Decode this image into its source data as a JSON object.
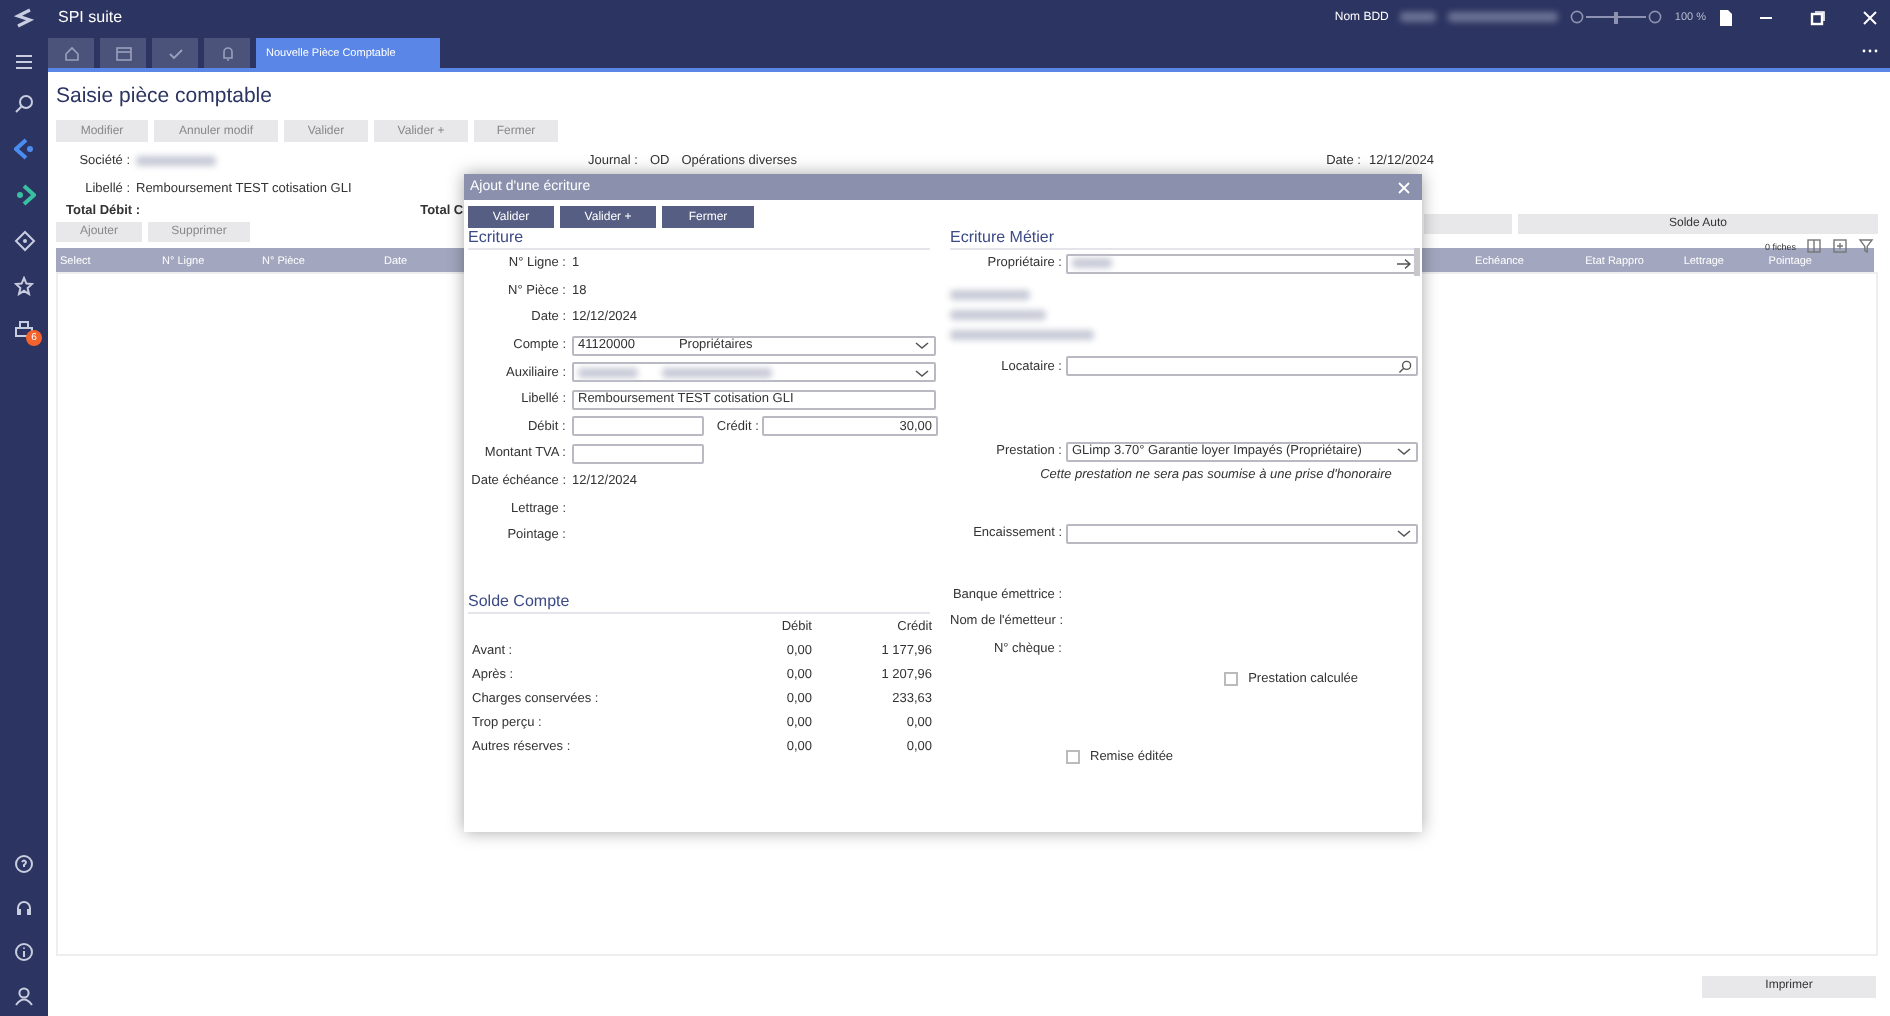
{
  "window": {
    "title": "SPI suite",
    "db_label": "Nom BDD",
    "zoom": "100 %",
    "zoom_slider": {
      "level": 0.5
    }
  },
  "tabs": [
    {
      "label": "Nouvelle Pièce Comptable",
      "selected": true
    }
  ],
  "sidebar": {
    "badge": "6"
  },
  "page": {
    "title": "Saisie pièce comptable",
    "toolbar": [
      {
        "label": "Modifier",
        "disabled": true
      },
      {
        "label": "Annuler modif",
        "disabled": true
      },
      {
        "label": "Valider",
        "disabled": true
      },
      {
        "label": "Valider +",
        "disabled": true
      },
      {
        "label": "Fermer",
        "disabled": true
      }
    ],
    "societe_label": "Société :",
    "libelle_label": "Libellé :",
    "libelle_value": "Remboursement TEST cotisation GLI",
    "journal_label": "Journal :",
    "journal_code": "OD",
    "journal_name": "Opérations diverses",
    "date_label": "Date :",
    "date_value": "12/12/2024",
    "total_debit": "Total Débit :",
    "total_credit": "Total C",
    "line_buttons": [
      {
        "label": "Ajouter",
        "disabled": true
      },
      {
        "label": "Supprimer",
        "disabled": true
      }
    ],
    "solde_button": "Solde Auto",
    "count": "0 fiches",
    "columns": [
      "Select",
      "N° Ligne",
      "N° Pièce",
      "Date",
      "Echéance",
      "Etat Rappro",
      "Lettrage",
      "Pointage"
    ],
    "print_button": "Imprimer"
  },
  "dialog": {
    "title": "Ajout d'une écriture",
    "buttons": [
      "Valider",
      "Valider +",
      "Fermer"
    ],
    "ecriture": {
      "heading": "Ecriture",
      "rows": [
        {
          "kind": "text",
          "label": "N° Ligne :",
          "value": "1"
        },
        {
          "kind": "text",
          "label": "N° Pièce :",
          "value": "18"
        },
        {
          "kind": "text",
          "label": "Date :",
          "value": "12/12/2024"
        },
        {
          "kind": "select",
          "label": "Compte :",
          "value": "41120000",
          "value_2": "Propriétaires"
        },
        {
          "kind": "select",
          "label": "Auxiliaire :",
          "redacted": true
        },
        {
          "kind": "input",
          "label": "Libellé :",
          "value": "Remboursement TEST cotisation GLI"
        },
        {
          "kind": "pair",
          "label": "Débit :",
          "label_2": "Crédit :",
          "value_2": "30,00"
        },
        {
          "kind": "short",
          "label": "Montant TVA :"
        },
        {
          "kind": "text",
          "label": "Date échéance :",
          "value": "12/12/2024"
        },
        {
          "kind": "text",
          "label": "Lettrage :"
        },
        {
          "kind": "text",
          "label": "Pointage :"
        }
      ]
    },
    "solde": {
      "heading": "Solde Compte",
      "columns": [
        "Débit",
        "Crédit"
      ],
      "rows": [
        {
          "label": "Avant :",
          "debit": "0,00",
          "credit": "1 177,96"
        },
        {
          "label": "Après :",
          "debit": "0,00",
          "credit": "1 207,96"
        },
        {
          "label": "Charges conservées :",
          "debit": "0,00",
          "credit": "233,63"
        },
        {
          "label": "Trop perçu :",
          "debit": "0,00",
          "credit": "0,00"
        },
        {
          "label": "Autres réserves :",
          "debit": "0,00",
          "credit": "0,00"
        }
      ]
    },
    "metier": {
      "heading": "Ecriture Métier",
      "rows": [
        {
          "kind": "link",
          "label": "Propriétaire :",
          "redacted": true
        },
        {
          "kind": "blur"
        },
        {
          "kind": "search",
          "label": "Locataire :"
        },
        {
          "kind": "select",
          "label": "Prestation :",
          "value": "GLimp 3.70°  Garantie loyer Impayés (Propriétaire)"
        },
        {
          "kind": "note",
          "value": "Cette prestation ne sera pas soumise à une prise d'honoraire"
        },
        {
          "kind": "select",
          "label": "Encaissement :"
        },
        {
          "kind": "text",
          "label": "Banque émettrice :"
        },
        {
          "kind": "text",
          "label": "Nom de l'émetteur :"
        },
        {
          "kind": "text",
          "label": "N° chèque :"
        },
        {
          "kind": "check",
          "label": "Prestation calculée",
          "checked": false
        },
        {
          "kind": "check2",
          "label": "Remise éditée",
          "checked": false
        }
      ]
    }
  }
}
